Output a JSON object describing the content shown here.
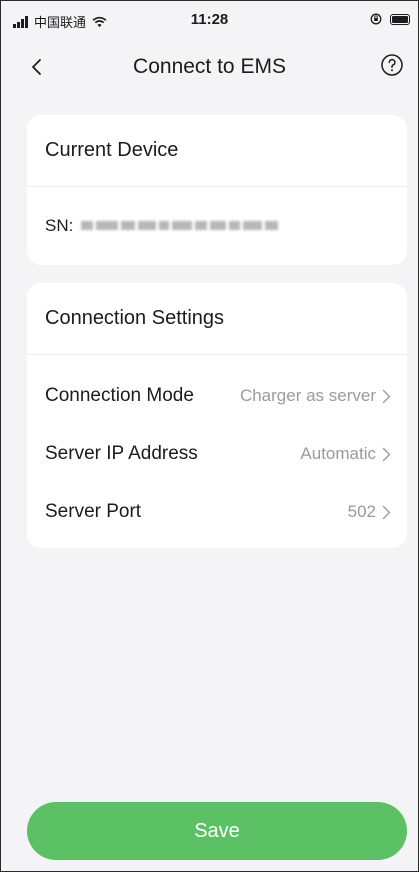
{
  "status_bar": {
    "carrier": "中国联通",
    "time": "11:28",
    "icons": [
      "signal-icon",
      "wifi-icon",
      "orientation-lock-icon",
      "battery-icon"
    ]
  },
  "nav": {
    "title": "Connect to EMS",
    "back_icon": "chevron-left-icon",
    "help_icon": "question-circle-icon"
  },
  "device_card": {
    "title": "Current Device",
    "sn_label": "SN:"
  },
  "settings_card": {
    "title": "Connection Settings",
    "rows": [
      {
        "label": "Connection Mode",
        "value": "Charger as server"
      },
      {
        "label": "Server IP Address",
        "value": "Automatic"
      },
      {
        "label": "Server Port",
        "value": "502"
      }
    ]
  },
  "save_button": {
    "label": "Save"
  },
  "colors": {
    "background": "#f4f4f6",
    "card": "#ffffff",
    "accent_green": "#5cc165",
    "value_gray": "#9a9aa0",
    "text": "#1c1c1e"
  }
}
